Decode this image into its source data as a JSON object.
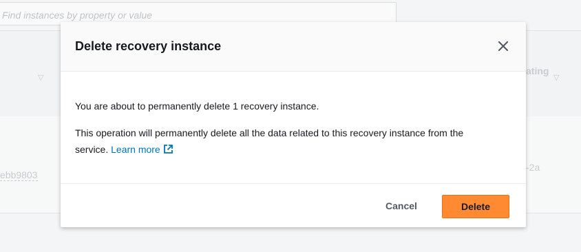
{
  "background": {
    "search_placeholder": "Find instances by property or value",
    "column_partial": "ating",
    "row_link_partial": "ebb9803",
    "row_cell_partial": "-2a"
  },
  "modal": {
    "title": "Delete recovery instance",
    "close_icon": "close-icon",
    "body": {
      "line1": "You are about to permanently delete 1 recovery instance.",
      "line2": "This operation will permanently delete all the data related to this recovery instance from the service.",
      "learn_more": "Learn more",
      "external_icon": "external-link-icon"
    },
    "footer": {
      "cancel_label": "Cancel",
      "delete_label": "Delete"
    }
  },
  "colors": {
    "primary_button": "#ff8a32",
    "link": "#0073bb",
    "text": "#16191f"
  }
}
